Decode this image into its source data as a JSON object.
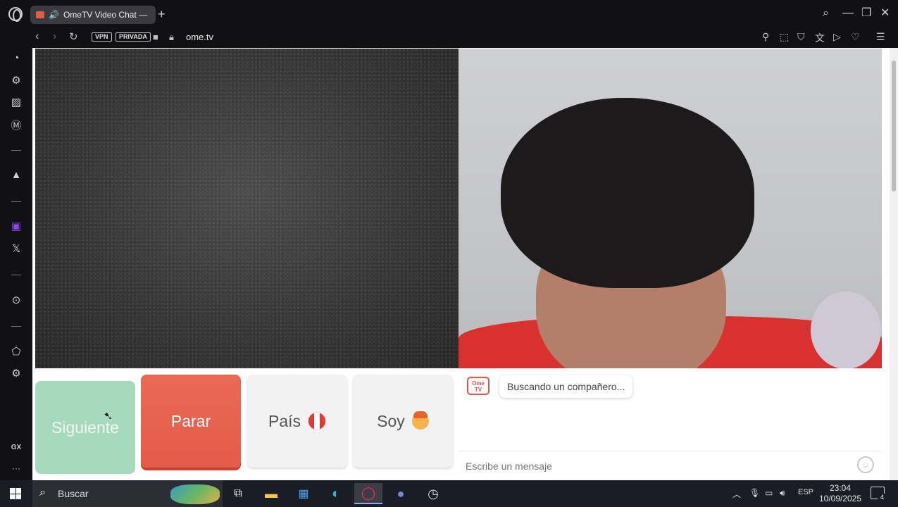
{
  "browser": {
    "tab_title": "OmeTV Video Chat —",
    "new_tab_label": "+",
    "badges": {
      "vpn": "VPN",
      "private": "PRIVADA"
    },
    "url": "ome.tv"
  },
  "sidebar": {
    "bottom_label": "GX",
    "more_label": "···"
  },
  "controls": {
    "next_label": "Siguiente",
    "stop_label": "Parar",
    "country_label": "País",
    "gender_label": "Soy",
    "country_flag_colors": [
      "#e53935",
      "#ffffff",
      "#e53935"
    ]
  },
  "chat": {
    "logo_text": "Ome TV",
    "status_message": "Buscando un compañero...",
    "input_placeholder": "Escribe un mensaje"
  },
  "taskbar": {
    "search_label": "Buscar",
    "language": "ESP",
    "time": "23:04",
    "date": "10/09/2025",
    "notification_count": "4"
  },
  "colors": {
    "next_button": "#a7d9bd",
    "stop_button": "#e65a48",
    "brand": "#e2574a"
  }
}
